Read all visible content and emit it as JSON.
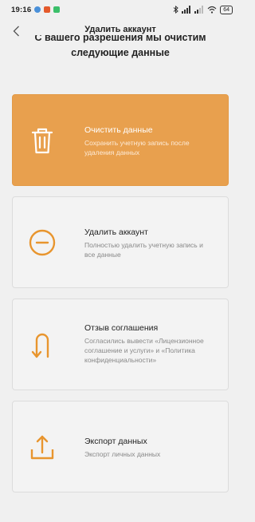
{
  "status": {
    "time": "19:16",
    "battery": "64"
  },
  "header": {
    "title": "Удалить аккаунт"
  },
  "intro": {
    "line1": "С вашего разрешения мы очистим",
    "line2": "следующие данные"
  },
  "options": [
    {
      "title": "Очистить данные",
      "desc": "Сохранить учетную запись после удаления данных",
      "icon": "trash-icon"
    },
    {
      "title": "Удалить аккаунт",
      "desc": "Полностью удалить учетную запись и все данные",
      "icon": "minus-circle-icon"
    },
    {
      "title": "Отзыв соглашения",
      "desc": "Согласились вывести «Лицензионное соглашение и услуги» и «Политика конфиденциальности»",
      "icon": "u-turn-icon"
    },
    {
      "title": "Экспорт данных",
      "desc": "Экспорт личных данных",
      "icon": "export-icon"
    }
  ],
  "colors": {
    "accent": "#e8a04e",
    "icon_orange": "#e8952e",
    "background": "#f0f0f0"
  }
}
